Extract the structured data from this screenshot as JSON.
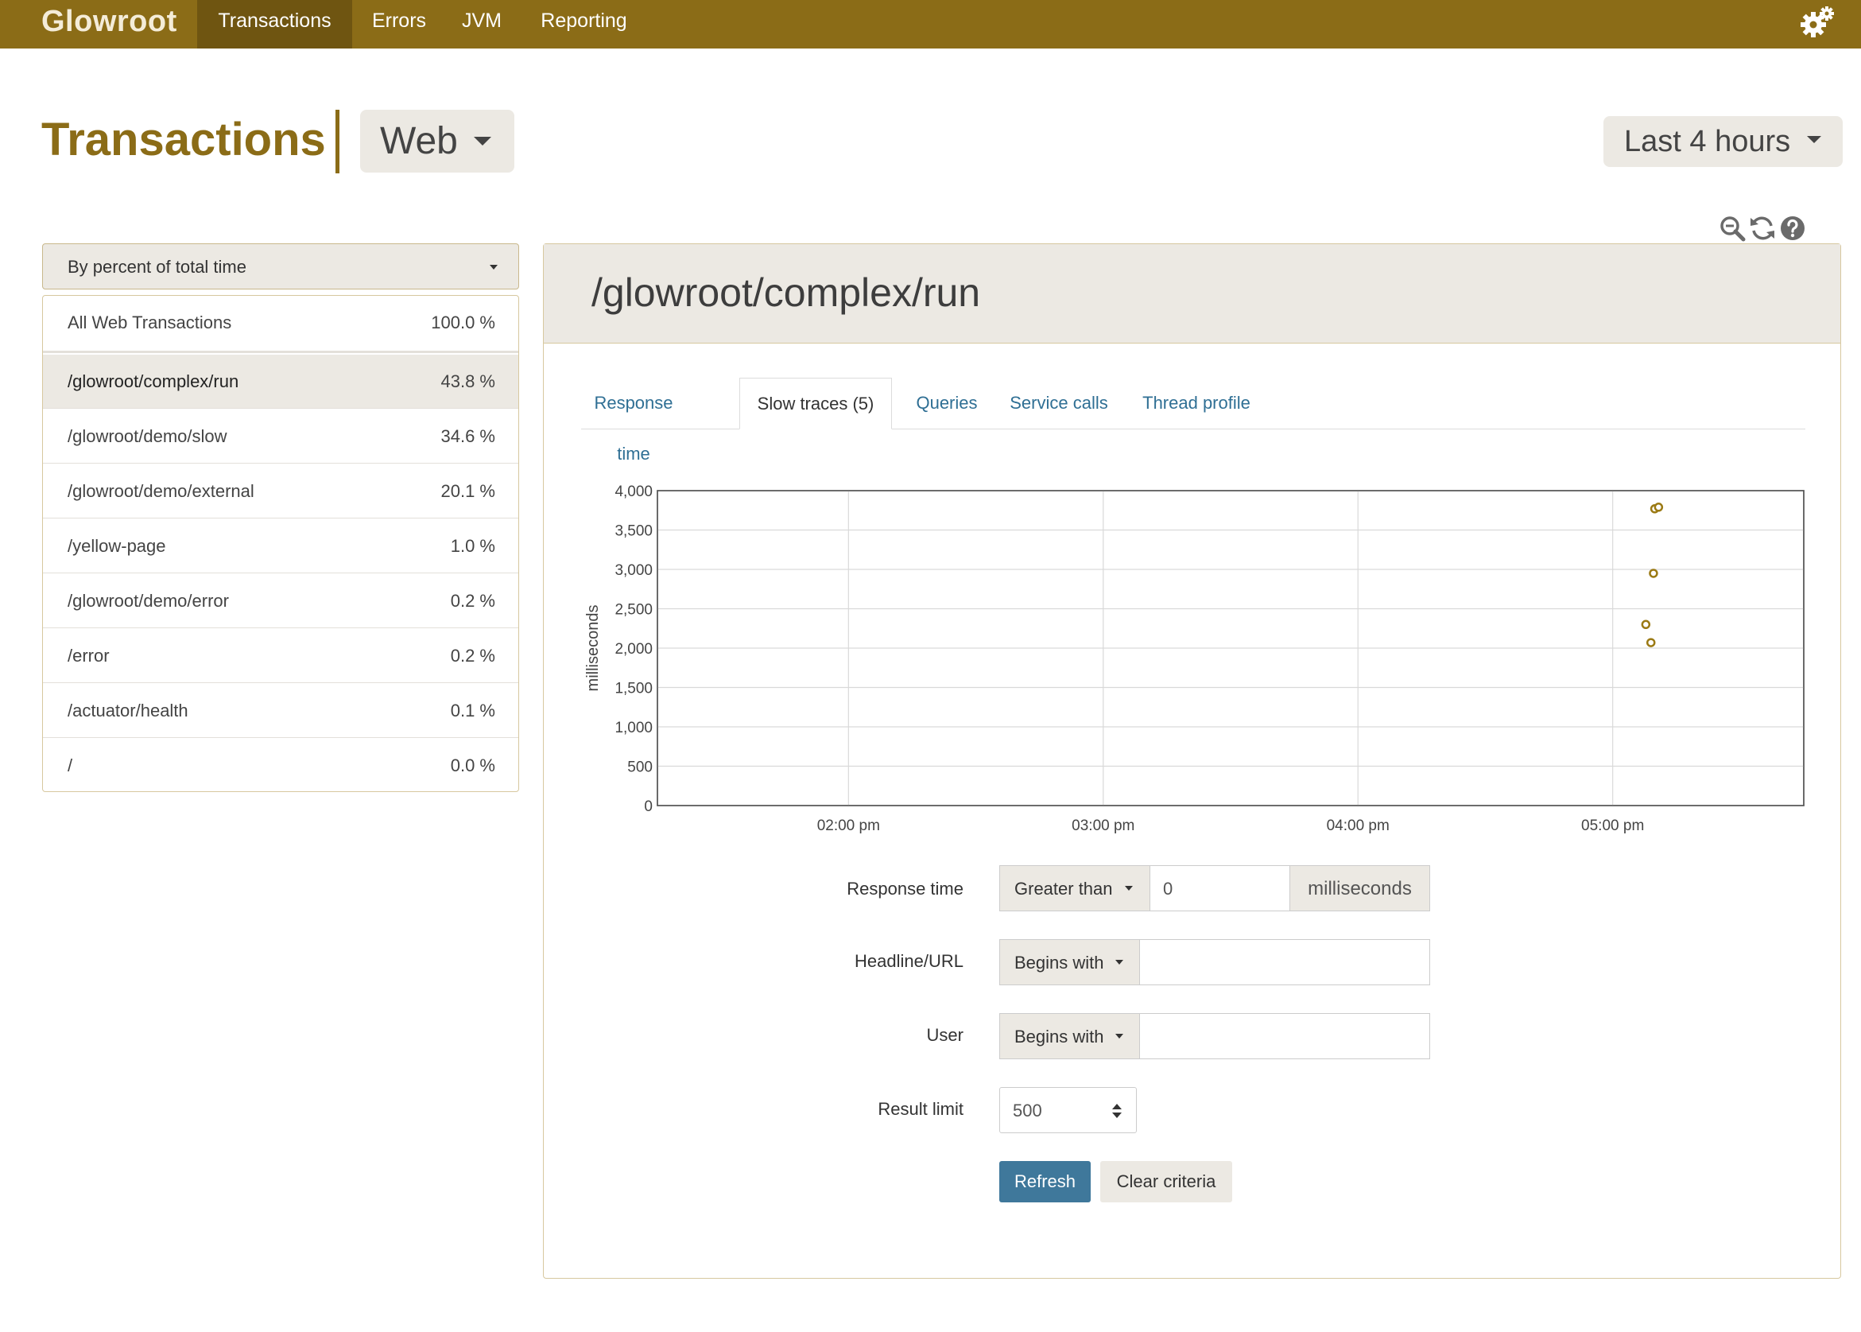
{
  "nav": {
    "brand": "Glowroot",
    "items": [
      {
        "label": "Transactions",
        "active": true
      },
      {
        "label": "Errors"
      },
      {
        "label": "JVM"
      },
      {
        "label": "Reporting"
      }
    ],
    "settings_icon": "gears-icon"
  },
  "header": {
    "title": "Transactions",
    "type_selector": "Web",
    "time_range": "Last 4 hours"
  },
  "sidebar": {
    "sort_by": "By percent of total time",
    "transactions": [
      {
        "name": "All Web Transactions",
        "percent": "100.0 %"
      },
      {
        "name": "/glowroot/complex/run",
        "percent": "43.8 %",
        "selected": true
      },
      {
        "name": "/glowroot/demo/slow",
        "percent": "34.6 %"
      },
      {
        "name": "/glowroot/demo/external",
        "percent": "20.1 %"
      },
      {
        "name": "/yellow-page",
        "percent": "1.0 %"
      },
      {
        "name": "/glowroot/demo/error",
        "percent": "0.2 %"
      },
      {
        "name": "/error",
        "percent": "0.2 %"
      },
      {
        "name": "/actuator/health",
        "percent": "0.1 %"
      },
      {
        "name": "/",
        "percent": "0.0 %"
      }
    ]
  },
  "main": {
    "title": "/glowroot/complex/run",
    "tabs": [
      {
        "label": "Response time"
      },
      {
        "label": "Slow traces (5)",
        "active": true
      },
      {
        "label": "Queries"
      },
      {
        "label": "Service calls"
      },
      {
        "label": "Thread profile"
      }
    ],
    "chart_tools": [
      "zoom-out-icon",
      "refresh-icon",
      "help-icon"
    ]
  },
  "chart_data": {
    "type": "scatter",
    "ylabel": "milliseconds",
    "xlabel": "",
    "ylim": [
      0,
      4000
    ],
    "y_ticks": [
      0,
      500,
      1000,
      1500,
      2000,
      2500,
      3000,
      3500,
      4000
    ],
    "y_tick_labels": [
      "0",
      "500",
      "1,000",
      "1,500",
      "2,000",
      "2,500",
      "3,000",
      "3,500",
      "4,000"
    ],
    "x_tick_labels": [
      "02:00 pm",
      "03:00 pm",
      "04:00 pm",
      "05:00 pm"
    ],
    "x_ticks_hours": [
      14,
      15,
      16,
      17
    ],
    "xlim_hours": [
      13.25,
      17.75
    ],
    "grid": true,
    "marker_color": "#9b7a14",
    "points": [
      {
        "time": "05:10 pm",
        "x_hours": 17.165,
        "y": 3770
      },
      {
        "time": "05:10 pm",
        "x_hours": 17.18,
        "y": 3790
      },
      {
        "time": "05:09 pm",
        "x_hours": 17.16,
        "y": 2950
      },
      {
        "time": "05:08 pm",
        "x_hours": 17.13,
        "y": 2300
      },
      {
        "time": "05:09 pm",
        "x_hours": 17.15,
        "y": 2070
      }
    ]
  },
  "filters": {
    "response_time": {
      "label": "Response time",
      "operator": "Greater than",
      "value": "0",
      "unit": "milliseconds"
    },
    "headline": {
      "label": "Headline/URL",
      "operator": "Begins with",
      "value": ""
    },
    "user": {
      "label": "User",
      "operator": "Begins with",
      "value": ""
    },
    "result_limit": {
      "label": "Result limit",
      "value": "500"
    },
    "refresh_label": "Refresh",
    "clear_label": "Clear criteria"
  }
}
